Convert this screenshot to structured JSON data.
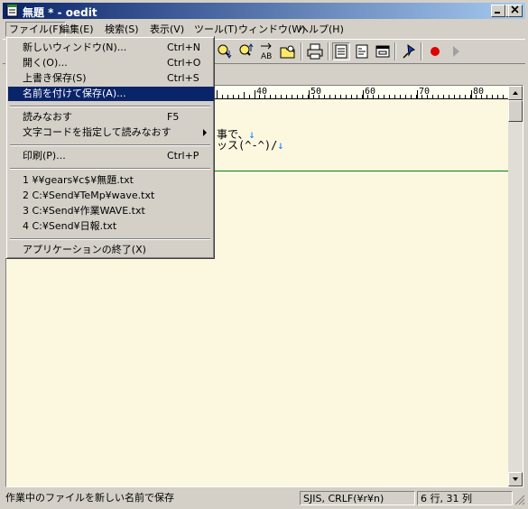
{
  "window": {
    "title": "無題 * - oedit"
  },
  "menubar": {
    "items": [
      {
        "label": "ファイル(F)"
      },
      {
        "label": "編集(E)"
      },
      {
        "label": "検索(S)"
      },
      {
        "label": "表示(V)"
      },
      {
        "label": "ツール(T)"
      },
      {
        "label": "ウィンドウ(W)"
      },
      {
        "label": "ヘルプ(H)"
      }
    ]
  },
  "file_menu": {
    "items": [
      {
        "label": "新しいウィンドウ(N)...",
        "shortcut": "Ctrl+N"
      },
      {
        "label": "開く(O)...",
        "shortcut": "Ctrl+O"
      },
      {
        "label": "上書き保存(S)",
        "shortcut": "Ctrl+S"
      },
      {
        "label": "名前を付けて保存(A)...",
        "shortcut": ""
      },
      {
        "label": "読みなおす",
        "shortcut": "F5"
      },
      {
        "label": "文字コードを指定して読みなおす",
        "shortcut": ""
      },
      {
        "label": "印刷(P)...",
        "shortcut": "Ctrl+P"
      },
      {
        "label": "1 ¥¥gears¥c$¥無題.txt",
        "shortcut": ""
      },
      {
        "label": "2 C:¥Send¥TeMp¥wave.txt",
        "shortcut": ""
      },
      {
        "label": "3 C:¥Send¥作業WAVE.txt",
        "shortcut": ""
      },
      {
        "label": "4 C:¥Send¥日報.txt",
        "shortcut": ""
      },
      {
        "label": "アプリケーションの終了(X)",
        "shortcut": ""
      }
    ]
  },
  "ruler": {
    "numbers": [
      "40",
      "50",
      "60",
      "70",
      "80"
    ]
  },
  "editor": {
    "lines": [
      {
        "text": "事で、",
        "eol": "↓"
      },
      {
        "text": "ッス(^-^)/",
        "eol": "↓"
      }
    ]
  },
  "statusbar": {
    "message": "作業中のファイルを新しい名前で保存",
    "encoding": "SJIS, CRLF(¥r¥n)",
    "position": "6 行, 31 列"
  },
  "colors": {
    "title_start": "#0a246a",
    "title_end": "#a6caf0",
    "highlight": "#0a246a",
    "editor_bg": "#fcf8e0",
    "eol_mark": "#0080ff",
    "eof_line": "#008000"
  }
}
